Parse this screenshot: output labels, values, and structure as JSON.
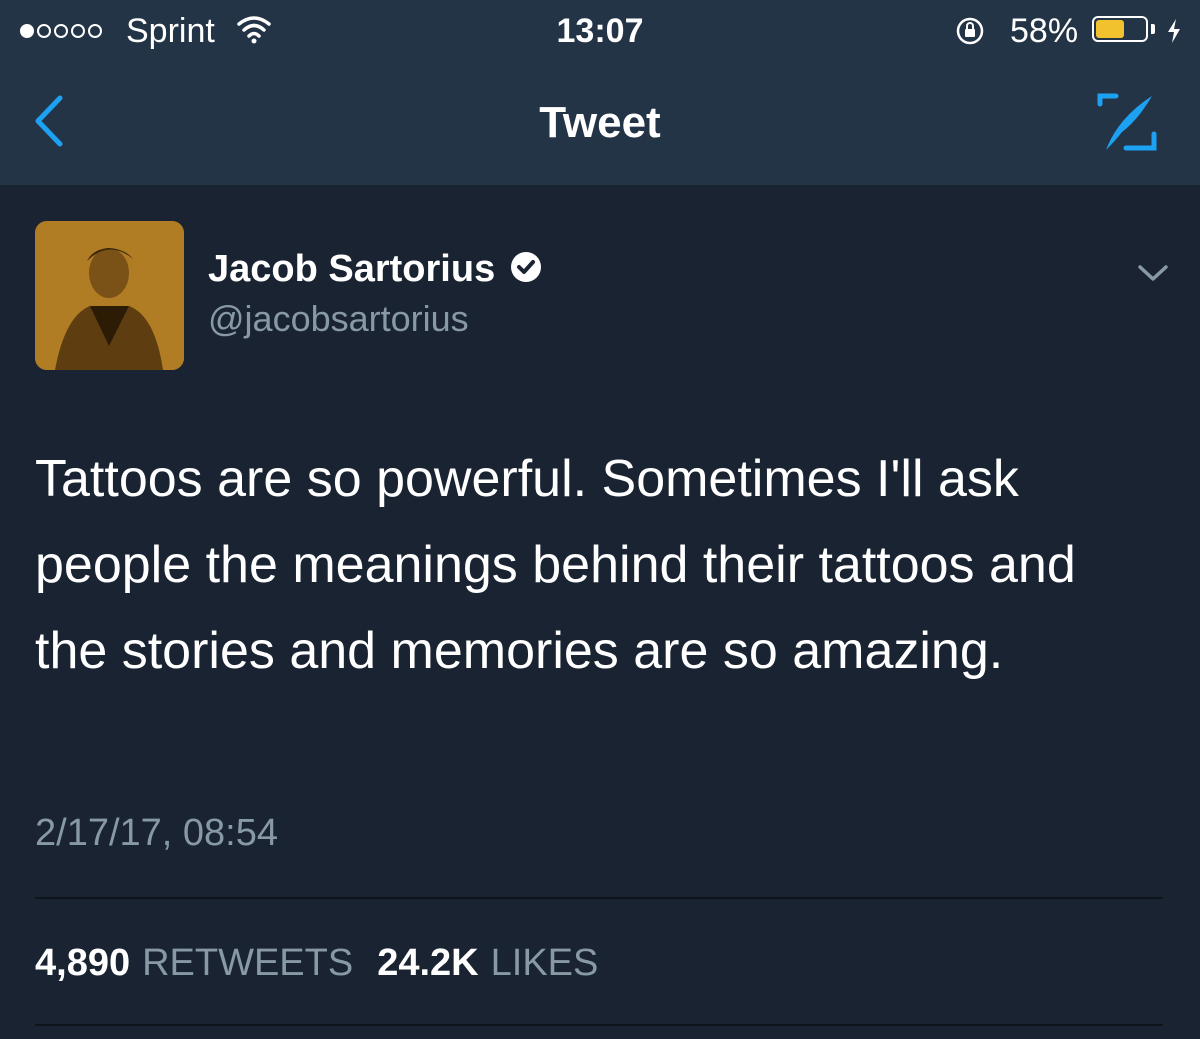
{
  "status_bar": {
    "signal_bars_filled": 1,
    "signal_bars_total": 5,
    "carrier": "Sprint",
    "time": "13:07",
    "battery_percent_text": "58%",
    "battery_level": 0.58,
    "battery_color": "#f2c12e",
    "icons": [
      "wifi-icon",
      "orientation-lock-icon",
      "battery-icon",
      "charging-bolt-icon"
    ]
  },
  "nav": {
    "title": "Tweet",
    "accent_color": "#1da1f2",
    "icons": [
      "back-chevron-icon",
      "compose-tweet-icon"
    ]
  },
  "tweet": {
    "author_name": "Jacob Sartorius",
    "verified": true,
    "handle": "@jacobsartorius",
    "text": "Tattoos are so powerful. Sometimes I'll ask people the meanings behind their tattoos and the stories and memories are so amazing.",
    "timestamp": "2/17/17, 08:54",
    "retweets_count": "4,890",
    "retweets_label": "RETWEETS",
    "likes_count": "24.2K",
    "likes_label": "LIKES"
  },
  "colors": {
    "background": "#1a2332",
    "header_background": "#243447",
    "secondary_text": "#8899a6"
  }
}
